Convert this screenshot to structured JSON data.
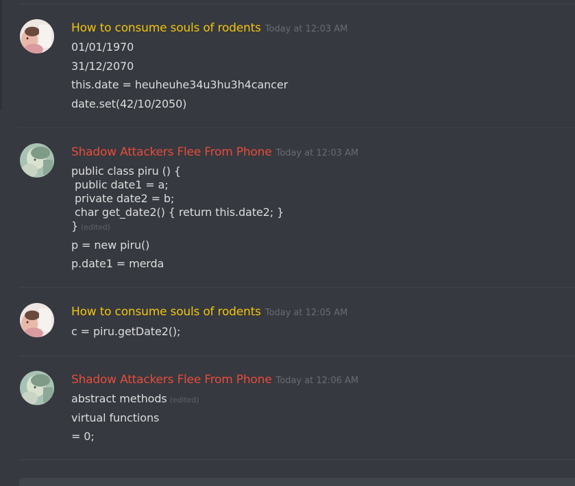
{
  "colors": {
    "background": "#36393f",
    "user_yellow": "#f1c40f",
    "user_red": "#e74c3c",
    "text": "#dcddde",
    "muted": "#686c73"
  },
  "messages": [
    {
      "author": "How to consume souls of rodents",
      "timestamp": "Today at 12:03 AM",
      "avatar_icon": "portrait-avatar-icon",
      "lines": [
        {
          "text": "01/01/1970"
        },
        {
          "text": "31/12/2070"
        },
        {
          "text": "this.date = heuheuhe34u3hu3h4cancer"
        },
        {
          "text": "date.set(42/10/2050)"
        }
      ]
    },
    {
      "author": "Shadow Attackers Flee From Phone",
      "timestamp": "Today at 12:03 AM",
      "avatar_icon": "anime-avatar-icon",
      "lines": [
        {
          "text": "public class piru () {"
        },
        {
          "text": " public date1 = a;"
        },
        {
          "text": " private date2 = b;"
        },
        {
          "text": " char get_date2() { return this.date2; }"
        },
        {
          "text": "}",
          "edited": "(edited)"
        },
        {
          "text": "p = new piru()"
        },
        {
          "text": "p.date1 = merda"
        }
      ]
    },
    {
      "author": "How to consume souls of rodents",
      "timestamp": "Today at 12:05 AM",
      "avatar_icon": "portrait-avatar-icon",
      "lines": [
        {
          "text": "c = piru.getDate2();"
        }
      ]
    },
    {
      "author": "Shadow Attackers Flee From Phone",
      "timestamp": "Today at 12:06 AM",
      "avatar_icon": "anime-avatar-icon",
      "lines": [
        {
          "text": "abstract methods",
          "edited": "(edited)"
        },
        {
          "text": "virtual functions"
        },
        {
          "text": "= 0;"
        }
      ]
    }
  ]
}
